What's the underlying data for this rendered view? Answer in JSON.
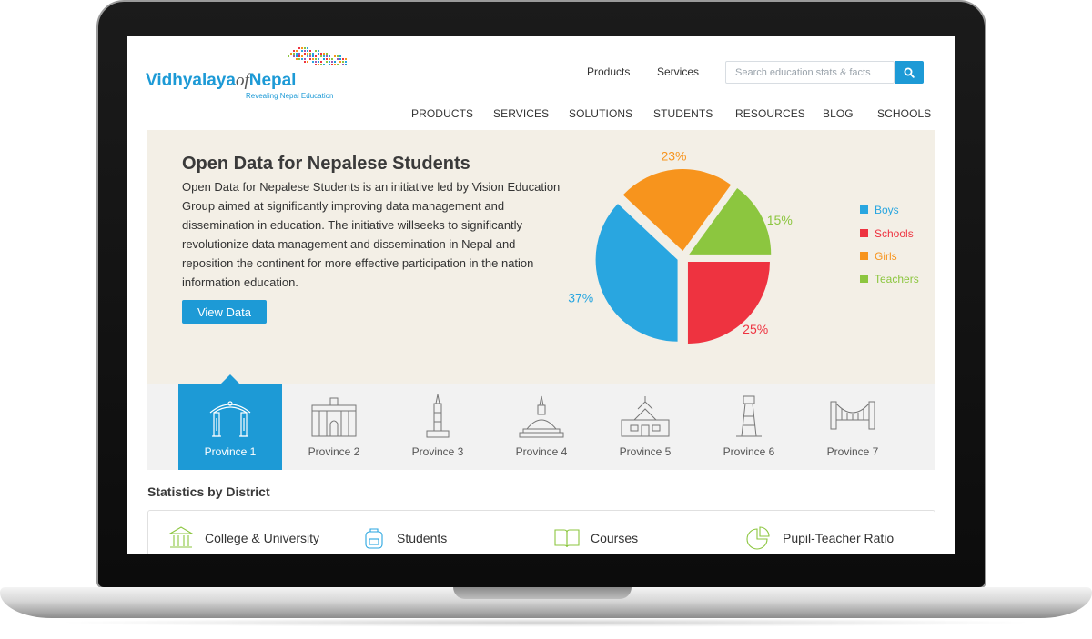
{
  "header": {
    "logo": {
      "brand": "Vidhyalaya",
      "of": "of",
      "nepal": "Nepal",
      "tagline": "Revealing Nepal Education"
    },
    "top_links": [
      "Products",
      "Services"
    ],
    "search": {
      "placeholder": "Search education stats & facts",
      "icon": "search-icon"
    },
    "nav": [
      "PRODUCTS",
      "SERVICES",
      "SOLUTIONS",
      "STUDENTS",
      "RESOURCES",
      "BLOG",
      "SCHOOLS"
    ]
  },
  "hero": {
    "title": "Open Data for Nepalese Students",
    "description": "Open Data for Nepalese Students is an initiative led by Vision Education Group aimed at significantly improving data management and dissemination in education. The initiative willseeks to significantly revolutionize data management and dissemination in Nepal and reposition the continent for more effective participation in the nation information education.",
    "button_label": "View Data"
  },
  "chart_data": {
    "type": "pie",
    "slices": [
      {
        "label": "Boys",
        "value": 37,
        "display": "37%",
        "color": "#29a6e0"
      },
      {
        "label": "Schools",
        "value": 25,
        "display": "25%",
        "color": "#ee3340"
      },
      {
        "label": "Girls",
        "value": 23,
        "display": "23%",
        "color": "#f7941d"
      },
      {
        "label": "Teachers",
        "value": 15,
        "display": "15%",
        "color": "#8cc63f"
      }
    ],
    "legend_position": "right"
  },
  "provinces": [
    {
      "label": "Province 1",
      "icon": "gate-icon",
      "active": true
    },
    {
      "label": "Province 2",
      "icon": "palace-icon",
      "active": false
    },
    {
      "label": "Province 3",
      "icon": "tower-icon",
      "active": false
    },
    {
      "label": "Province 4",
      "icon": "stupa-icon",
      "active": false
    },
    {
      "label": "Province 5",
      "icon": "temple-icon",
      "active": false
    },
    {
      "label": "Province 6",
      "icon": "lighthouse-icon",
      "active": false
    },
    {
      "label": "Province 7",
      "icon": "bridge-icon",
      "active": false
    }
  ],
  "statistics": {
    "title": "Statistics by District",
    "items": [
      {
        "label": "College & University",
        "icon": "building-icon"
      },
      {
        "label": "Students",
        "icon": "backpack-icon"
      },
      {
        "label": "Courses",
        "icon": "book-icon"
      },
      {
        "label": "Pupil-Teacher Ratio",
        "icon": "pie-chart-icon"
      }
    ]
  },
  "colors": {
    "accent": "#1d9ad6",
    "hero_bg": "#f3efe6",
    "province_bg": "#f2f2f2"
  }
}
